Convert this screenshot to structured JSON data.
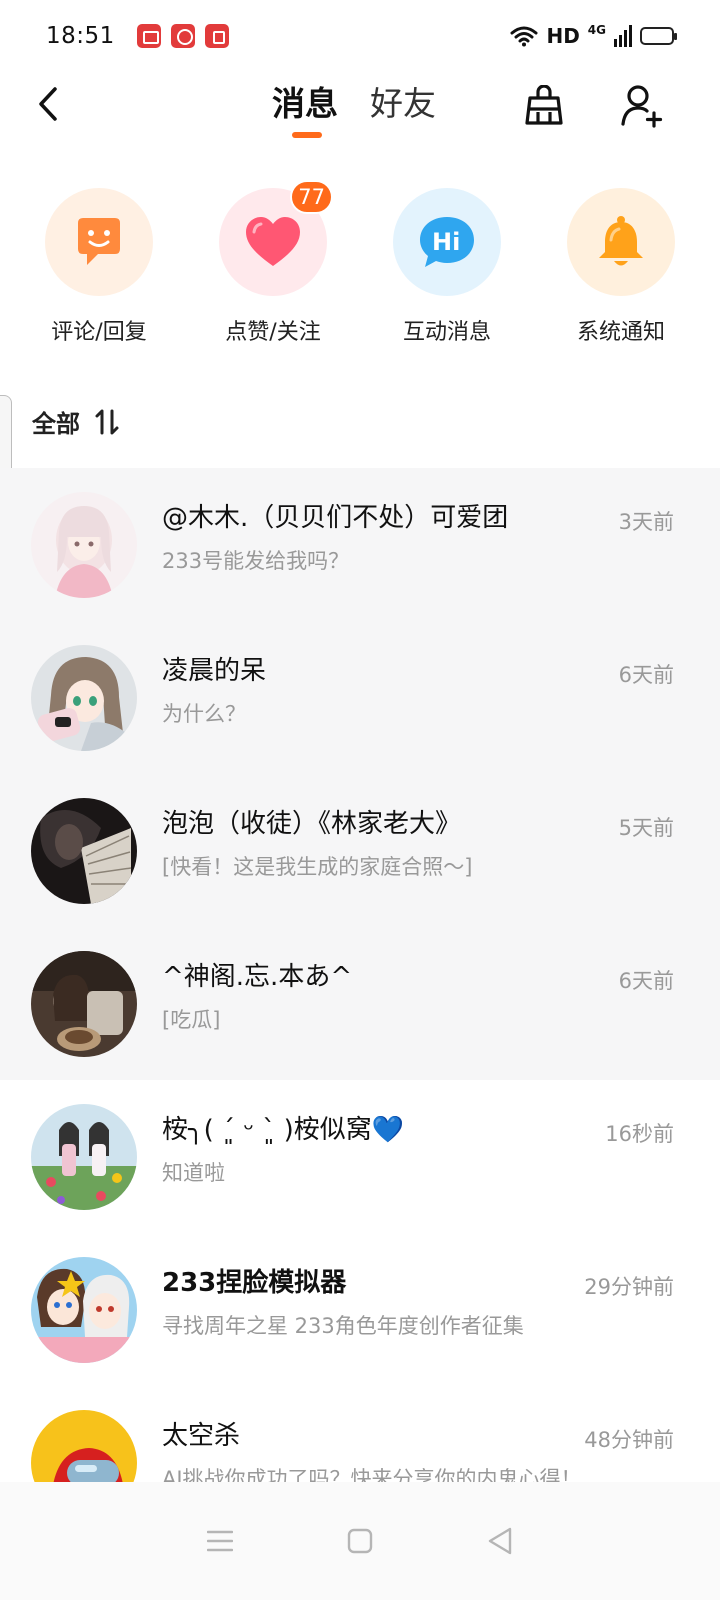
{
  "status_bar": {
    "time": "18:51",
    "hd": "HD",
    "network": "4G"
  },
  "header": {
    "tabs": [
      {
        "label": "消息",
        "active": true
      },
      {
        "label": "好友",
        "active": false
      }
    ],
    "icons": [
      "back-icon",
      "broom-icon",
      "add-friend-icon"
    ]
  },
  "categories": [
    {
      "label": "评论/回复",
      "icon": "comment-icon",
      "color": "#ff8a3d",
      "bg": "#fff0e3"
    },
    {
      "label": "点赞/关注",
      "icon": "heart-icon",
      "color": "#ff5773",
      "bg": "#ffe9ec",
      "badge": "77"
    },
    {
      "label": "互动消息",
      "icon": "hi-icon",
      "color": "#2fa6ef",
      "bg": "#e3f3fd"
    },
    {
      "label": "系统通知",
      "icon": "bell-icon",
      "color": "#ffa21a",
      "bg": "#fff0dd"
    }
  ],
  "filter": {
    "label": "全部",
    "sort_icon": "sort-icon"
  },
  "conversations": [
    {
      "name": "@木木.（贝贝们不处）可爱团",
      "message": "233号能发给我吗？",
      "time": "3天前",
      "highlighted": true
    },
    {
      "name": "凌晨的呆",
      "message": "为什么？",
      "time": "6天前",
      "highlighted": true
    },
    {
      "name": "泡泡（收徒）《林家老大》",
      "message": "[快看！这是我生成的家庭合照～]",
      "time": "5天前",
      "highlighted": true
    },
    {
      "name": "^神阁.忘.本あ^",
      "message": "[吃瓜]",
      "time": "6天前",
      "highlighted": true
    },
    {
      "name": "桉╮( ´͈ ᵕ `͈ )桉似窝💙",
      "message": "知道啦",
      "time": "16秒前",
      "highlighted": false
    },
    {
      "name": "233捏脸模拟器",
      "message": "寻找周年之星 233角色年度创作者征集",
      "time": "29分钟前",
      "highlighted": false
    },
    {
      "name": "太空杀",
      "message": "AI挑战你成功了吗？快来分享你的内鬼心得！",
      "time": "48分钟前",
      "highlighted": false
    }
  ],
  "colors": {
    "accent": "#ff6a1a",
    "highlight_row": "#f6f6f7",
    "secondary_text": "#999999"
  },
  "navbar": [
    "menu-icon",
    "home-icon",
    "back-triangle-icon"
  ]
}
